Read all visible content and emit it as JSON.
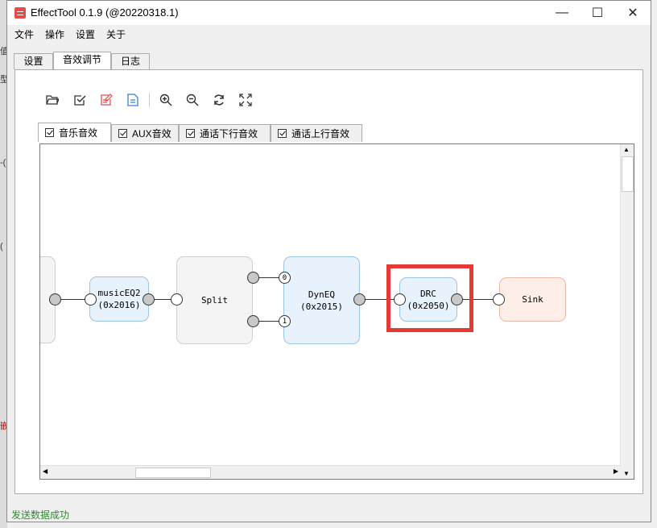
{
  "window": {
    "title": "EffectTool 0.1.9  (@20220318.1)",
    "minimize": "—",
    "maximize": "☐",
    "close": "✕"
  },
  "menu": [
    "文件",
    "操作",
    "设置",
    "关于"
  ],
  "tabs": [
    {
      "label": "设置"
    },
    {
      "label": "音效调节",
      "active": true
    },
    {
      "label": "日志"
    }
  ],
  "toolbar": [
    {
      "name": "open-folder-icon"
    },
    {
      "name": "check-icon"
    },
    {
      "name": "edit-icon",
      "color": "#e05050"
    },
    {
      "name": "save-doc-icon",
      "color": "#3b82d6"
    },
    {
      "name": "zoom-in-icon"
    },
    {
      "name": "zoom-out-icon"
    },
    {
      "name": "refresh-icon"
    },
    {
      "name": "fit-icon"
    }
  ],
  "effect_tabs": [
    {
      "label": "音乐音效",
      "checked": true,
      "active": true
    },
    {
      "label": "AUX音效",
      "checked": true
    },
    {
      "label": "通话下行音效",
      "checked": true
    },
    {
      "label": "通话上行音效",
      "checked": true
    }
  ],
  "graph": {
    "nodes": [
      {
        "id": "musiceq2",
        "line1": "musicEQ2",
        "line2": "(0x2016)"
      },
      {
        "id": "split",
        "line1": "Split",
        "line2": ""
      },
      {
        "id": "dyneq",
        "line1": "DynEQ",
        "line2": "(0x2015)"
      },
      {
        "id": "drc",
        "line1": "DRC",
        "line2": "(0x2050)",
        "highlighted": true
      },
      {
        "id": "sink",
        "line1": "Sink",
        "line2": ""
      }
    ],
    "port_labels": {
      "split_out_top": "0",
      "split_out_bottom": "1"
    },
    "colors": {
      "highlight": "#e53935",
      "blue_node_fill": "#e8f2fd",
      "blue_node_border": "#9cc3e8",
      "gray_node_fill": "#f4f4f4",
      "sink_fill": "#fdeee8",
      "sink_border": "#f0b8a6"
    }
  },
  "status": {
    "text": "发送数据成功",
    "color": "#2e8b2e"
  },
  "background_glyphs": [
    "值",
    "型",
    "-(",
    "(",
    "嵌"
  ]
}
